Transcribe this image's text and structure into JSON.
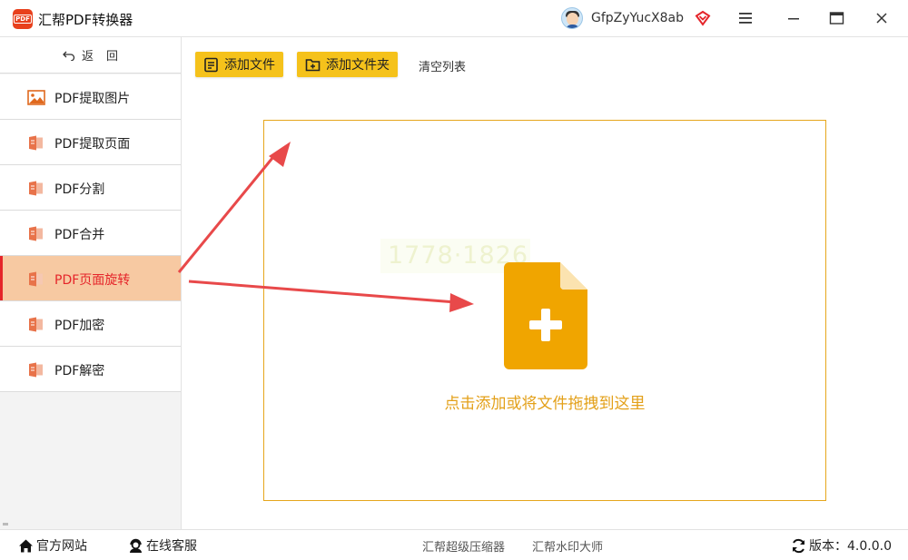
{
  "app": {
    "title": "汇帮PDF转换器",
    "logo_text": "PDF",
    "username": "GfpZyYucX8ab"
  },
  "sidebar": {
    "back_label": "返回",
    "items": [
      {
        "label": "PDF提取图片",
        "icon": "image-icon",
        "active": false
      },
      {
        "label": "PDF提取页面",
        "icon": "pdf-file-icon",
        "active": false
      },
      {
        "label": "PDF分割",
        "icon": "pdf-file-icon",
        "active": false
      },
      {
        "label": "PDF合并",
        "icon": "pdf-file-icon",
        "active": false
      },
      {
        "label": "PDF页面旋转",
        "icon": "pdf-file-icon",
        "active": true
      },
      {
        "label": "PDF加密",
        "icon": "pdf-file-icon",
        "active": false
      },
      {
        "label": "PDF解密",
        "icon": "pdf-file-icon",
        "active": false
      }
    ]
  },
  "toolbar": {
    "add_file_label": "添加文件",
    "add_folder_label": "添加文件夹",
    "clear_label": "清空列表"
  },
  "dropzone": {
    "watermark_text": "1778·1826",
    "hint": "点击添加或将文件拖拽到这里"
  },
  "footer": {
    "site_label": "官方网站",
    "support_label": "在线客服",
    "compress_label": "汇帮超级压缩器",
    "watermark_label": "汇帮水印大师",
    "version_label": "版本：4.0.0.0"
  },
  "colors": {
    "accent_yellow": "#f5c21b",
    "active_bg": "#f7c9a2",
    "active_text": "#e5252a",
    "dropzone_border": "#e6a61c",
    "file_icon": "#f0a500",
    "annotation_arrow": "#e8494a"
  }
}
